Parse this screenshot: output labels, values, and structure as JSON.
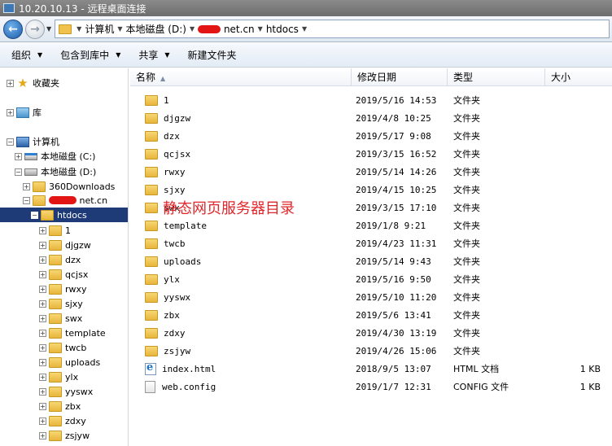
{
  "window": {
    "title": "10.20.10.13 - 远程桌面连接"
  },
  "address": {
    "segments": [
      "计算机",
      "本地磁盘 (D:)",
      "net.cn",
      "htdocs"
    ],
    "separator": "▸"
  },
  "toolbar": {
    "organize": "组织",
    "include_library": "包含到库中",
    "share": "共享",
    "new_folder": "新建文件夹"
  },
  "nav": {
    "favorites": "收藏夹",
    "libraries": "库",
    "computer": "计算机",
    "drive_c": "本地磁盘 (C:)",
    "drive_d": "本地磁盘 (D:)",
    "downloads": "360Downloads",
    "site": "net.cn",
    "htdocs": "htdocs",
    "children": [
      "1",
      "djgzw",
      "dzx",
      "qcjsx",
      "rwxy",
      "sjxy",
      "swx",
      "template",
      "twcb",
      "uploads",
      "ylx",
      "yyswx",
      "zbx",
      "zdxy",
      "zsjyw"
    ]
  },
  "columns": {
    "name": "名称",
    "date": "修改日期",
    "type": "类型",
    "size": "大小"
  },
  "files": [
    {
      "name": "1",
      "date": "2019/5/16 14:53",
      "type": "文件夹",
      "size": "",
      "icon": "folder-icon"
    },
    {
      "name": "djgzw",
      "date": "2019/4/8 10:25",
      "type": "文件夹",
      "size": "",
      "icon": "folder-icon"
    },
    {
      "name": "dzx",
      "date": "2019/5/17 9:08",
      "type": "文件夹",
      "size": "",
      "icon": "folder-icon"
    },
    {
      "name": "qcjsx",
      "date": "2019/3/15 16:52",
      "type": "文件夹",
      "size": "",
      "icon": "folder-icon"
    },
    {
      "name": "rwxy",
      "date": "2019/5/14 14:26",
      "type": "文件夹",
      "size": "",
      "icon": "folder-icon"
    },
    {
      "name": "sjxy",
      "date": "2019/4/15 10:25",
      "type": "文件夹",
      "size": "",
      "icon": "folder-icon"
    },
    {
      "name": "swx",
      "date": "2019/3/15 17:10",
      "type": "文件夹",
      "size": "",
      "icon": "folder-icon"
    },
    {
      "name": "template",
      "date": "2019/1/8 9:21",
      "type": "文件夹",
      "size": "",
      "icon": "folder-icon"
    },
    {
      "name": "twcb",
      "date": "2019/4/23 11:31",
      "type": "文件夹",
      "size": "",
      "icon": "folder-icon"
    },
    {
      "name": "uploads",
      "date": "2019/5/14 9:43",
      "type": "文件夹",
      "size": "",
      "icon": "folder-icon"
    },
    {
      "name": "ylx",
      "date": "2019/5/16 9:50",
      "type": "文件夹",
      "size": "",
      "icon": "folder-icon"
    },
    {
      "name": "yyswx",
      "date": "2019/5/10 11:20",
      "type": "文件夹",
      "size": "",
      "icon": "folder-icon"
    },
    {
      "name": "zbx",
      "date": "2019/5/6 13:41",
      "type": "文件夹",
      "size": "",
      "icon": "folder-icon"
    },
    {
      "name": "zdxy",
      "date": "2019/4/30 13:19",
      "type": "文件夹",
      "size": "",
      "icon": "folder-icon"
    },
    {
      "name": "zsjyw",
      "date": "2019/4/26 15:06",
      "type": "文件夹",
      "size": "",
      "icon": "folder-icon"
    },
    {
      "name": "index.html",
      "date": "2018/9/5 13:07",
      "type": "HTML 文档",
      "size": "1 KB",
      "icon": "html-file-icon"
    },
    {
      "name": "web.config",
      "date": "2019/1/7 12:31",
      "type": "CONFIG 文件",
      "size": "1 KB",
      "icon": "config-file-icon"
    }
  ],
  "annotation": "静态网页服务器目录"
}
